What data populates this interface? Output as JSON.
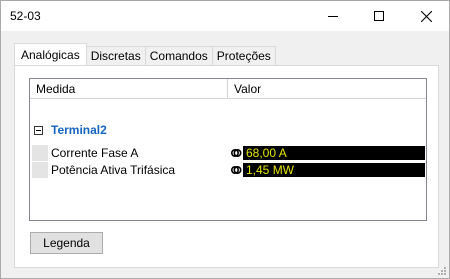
{
  "window": {
    "title": "52-03"
  },
  "tabs": [
    {
      "label": "Analógicas",
      "active": true
    },
    {
      "label": "Discretas",
      "active": false
    },
    {
      "label": "Comandos",
      "active": false
    },
    {
      "label": "Proteções",
      "active": false
    }
  ],
  "grid": {
    "headers": {
      "medida": "Medida",
      "valor": "Valor"
    },
    "group": {
      "label": "Terminal2",
      "expanded": true
    },
    "rows": [
      {
        "label": "Corrente Fase A",
        "value": "68,00 A"
      },
      {
        "label": "Potência Ativa Trifásica",
        "value": "1,45 MW"
      }
    ]
  },
  "buttons": {
    "legenda": "Legenda"
  },
  "colors": {
    "value_bg": "#000000",
    "value_fg": "#e6e600",
    "group_label": "#1565c0"
  }
}
